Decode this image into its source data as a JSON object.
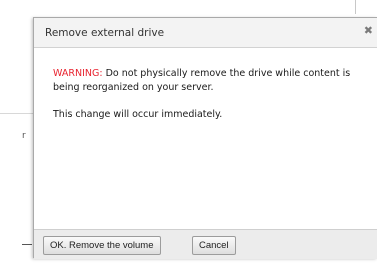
{
  "background": {
    "fragment_text": "r"
  },
  "dialog": {
    "title": "Remove external drive",
    "close_glyph": "✖",
    "warning_label": "WARNING:",
    "warning_text": " Do not physically remove the drive while content is being reorganized on your server.",
    "notice_text": "This change will occur immediately.",
    "confirm_label": "OK. Remove the volume",
    "cancel_label": "Cancel"
  },
  "colors": {
    "warning": "#e8232f",
    "header_bg": "#f3f3f3",
    "footer_bg": "#ececec"
  }
}
